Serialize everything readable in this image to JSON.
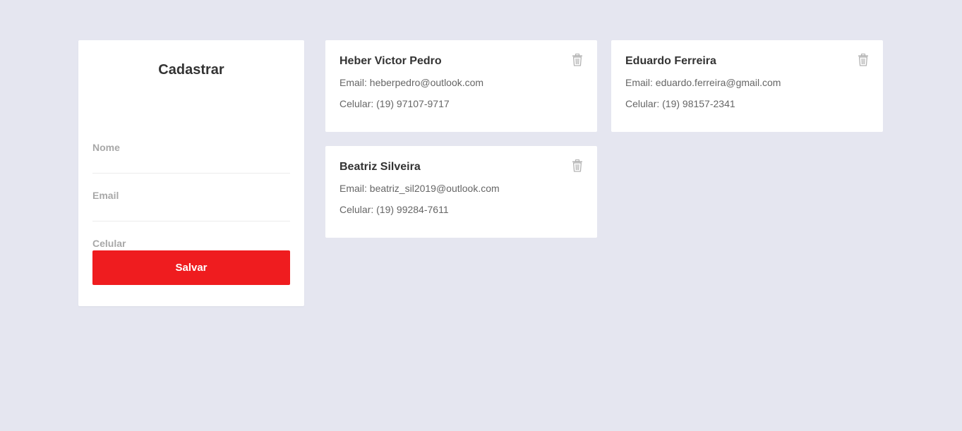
{
  "form": {
    "title": "Cadastrar",
    "fields": {
      "nome": {
        "placeholder": "Nome",
        "value": ""
      },
      "email": {
        "placeholder": "Email",
        "value": ""
      },
      "celular": {
        "placeholder": "Celular",
        "value": ""
      }
    },
    "save_label": "Salvar"
  },
  "contacts": [
    {
      "name": "Heber Victor Pedro",
      "email": "Email: heberpedro@outlook.com",
      "phone": "Celular: (19) 97107-9717"
    },
    {
      "name": "Eduardo Ferreira",
      "email": "Email: eduardo.ferreira@gmail.com",
      "phone": "Celular: (19) 98157-2341"
    },
    {
      "name": "Beatriz Silveira",
      "email": "Email: beatriz_sil2019@outlook.com",
      "phone": "Celular: (19) 99284-7611"
    }
  ],
  "icons": {
    "delete": "trash-icon"
  },
  "colors": {
    "background": "#e5e6f0",
    "card": "#ffffff",
    "accent": "#ef1c1f",
    "text_primary": "#333333",
    "text_secondary": "#666666",
    "placeholder": "#a8a8a8"
  }
}
